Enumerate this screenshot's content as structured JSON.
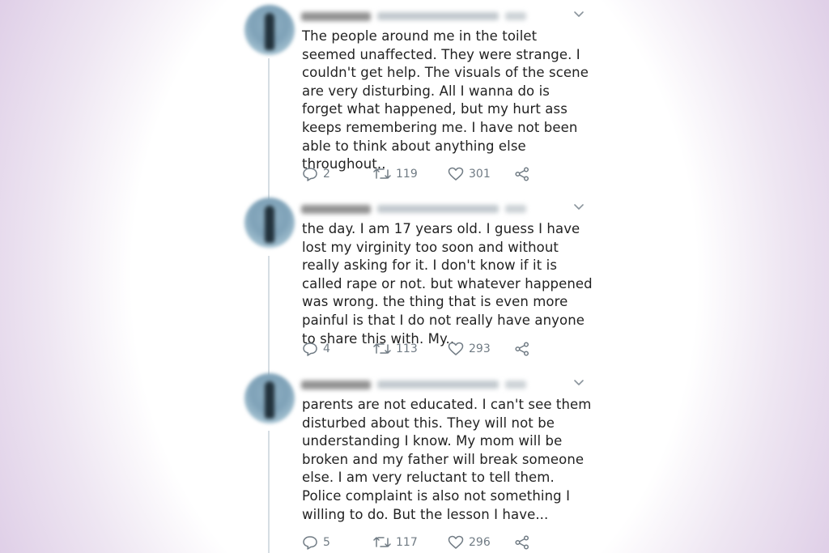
{
  "tweets": [
    {
      "text": "The people around me in the toilet seemed unaffected. They were strange. I couldn't get help. The visuals of the scene are very disturbing. All I wanna do is forget what happened, but my hurt ass keeps remembering me. I have not been able to think about anything else throughout..",
      "replies": "2",
      "retweets": "119",
      "likes": "301"
    },
    {
      "text": "the day. I am 17 years old. I guess I have lost my virginity too soon and without really asking for it. I don't know if it is called rape or not. but whatever happened was wrong. the thing that is even more painful is that I do not really have anyone to share this with. My..",
      "replies": "4",
      "retweets": "113",
      "likes": "293"
    },
    {
      "text": "parents are not educated. I can't see them disturbed about this. They will not be understanding I know. My mom will be broken and my father will break someone else. I am very reluctant to tell them. Police complaint is also not something I willing to do. But the lesson I have...",
      "replies": "5",
      "retweets": "117",
      "likes": "296"
    }
  ],
  "icons": {
    "reply": "reply-icon",
    "retweet": "retweet-icon",
    "like": "heart-icon",
    "share": "share-icon",
    "more": "chevron-down-icon"
  },
  "colors": {
    "text": "#222222",
    "icon": "#707b84",
    "thread_line": "#d6dde3",
    "background_tint": "#d8c4e2"
  }
}
